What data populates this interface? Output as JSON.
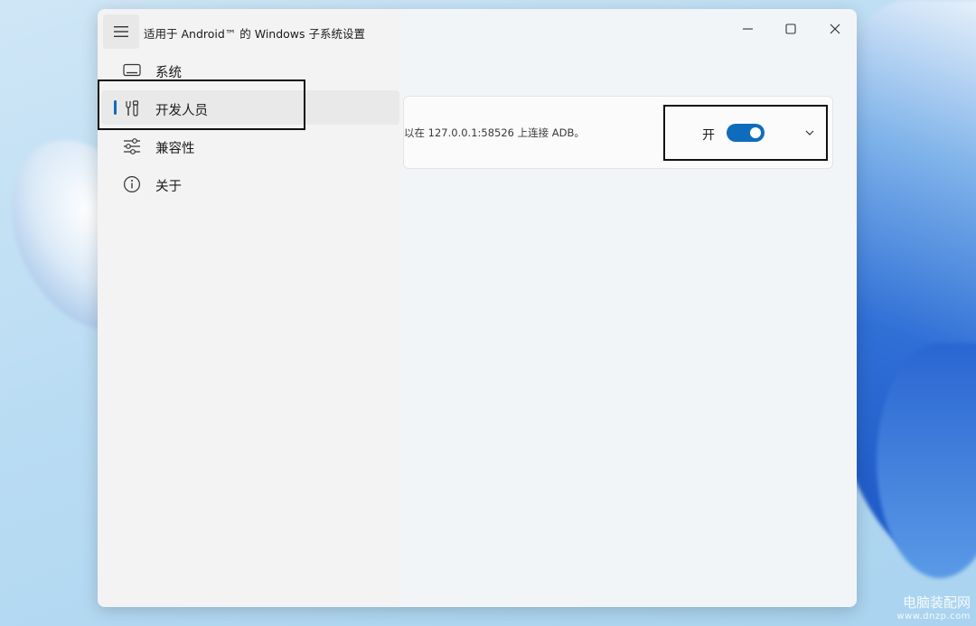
{
  "window": {
    "title": "适用于 Android™ 的 Windows 子系统设置"
  },
  "sidebar": {
    "items": [
      {
        "label": "系统",
        "icon": "monitor-icon"
      },
      {
        "label": "开发人员",
        "icon": "developer-tools-icon",
        "selected": true
      },
      {
        "label": "兼容性",
        "icon": "sliders-icon"
      },
      {
        "label": "关于",
        "icon": "info-icon"
      }
    ]
  },
  "developer_mode": {
    "description": "以在 127.0.0.1:58526 上连接 ADB。",
    "toggle_label": "开",
    "toggle_on": true
  },
  "watermark": {
    "name": "电脑装配网",
    "url": "www.dnzp.com"
  },
  "colors": {
    "accent": "#0f6cbd",
    "window_bg": "#f2f5f8",
    "sidebar_bg": "#f3f3f3"
  }
}
